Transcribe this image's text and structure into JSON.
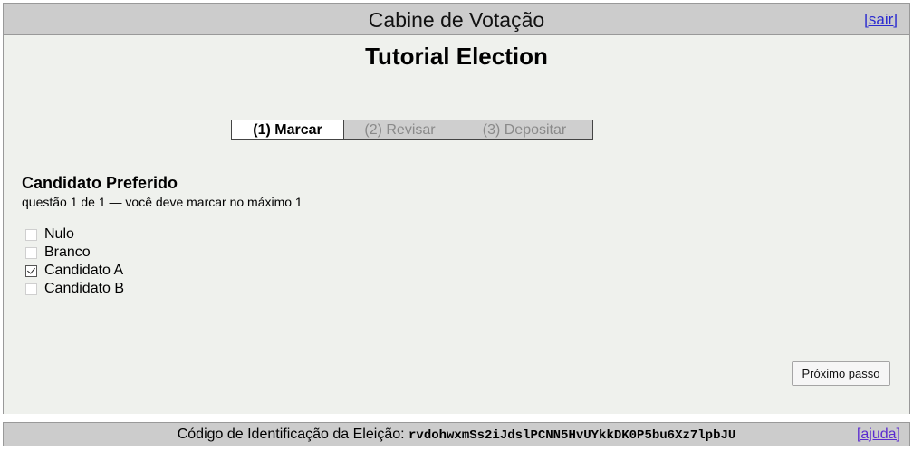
{
  "header": {
    "title": "Cabine de Votação",
    "exit_label": "[sair]"
  },
  "election": {
    "name": "Tutorial Election"
  },
  "steps": [
    {
      "label": "(1) Marcar",
      "active": true
    },
    {
      "label": "(2) Revisar",
      "active": false
    },
    {
      "label": "(3) Depositar",
      "active": false
    }
  ],
  "question": {
    "title": "Candidato Preferido",
    "info": "questão 1 de 1 — você deve marcar no máximo 1",
    "answers": [
      {
        "label": "Nulo",
        "checked": false
      },
      {
        "label": "Branco",
        "checked": false
      },
      {
        "label": "Candidato A",
        "checked": true
      },
      {
        "label": "Candidato B",
        "checked": false
      }
    ]
  },
  "next_button": "Próximo passo",
  "footer": {
    "label": "Código de Identificação da Eleição:",
    "tracker": "rvdohwxmSs2iJdslPCNN5HvUYkkDK0P5bu6Xz7lpbJU",
    "help_label": "[ajuda]"
  },
  "colors": {
    "bar_background": "#cccccc",
    "content_background": "#eff1ed",
    "link": "#2a2ad0"
  }
}
